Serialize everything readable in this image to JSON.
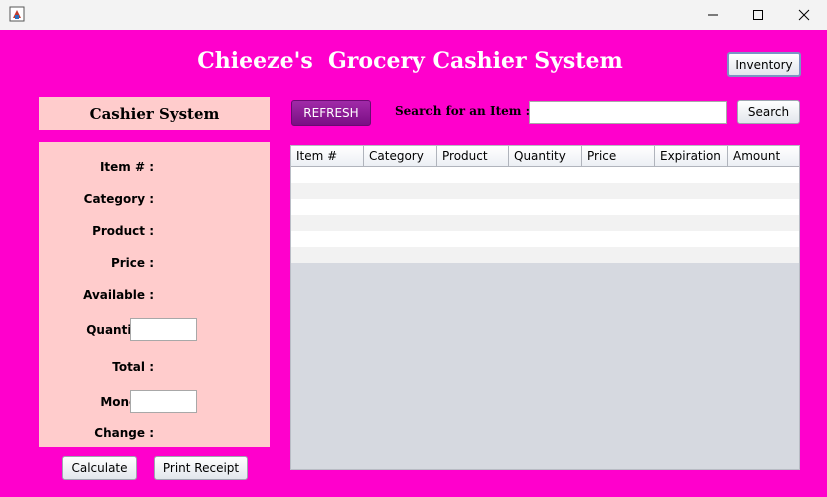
{
  "window": {
    "minimize_glyph": "—",
    "maximize_glyph": "☐",
    "close_glyph": "✕"
  },
  "header": {
    "title": "Chieeze's  Grocery Cashier System",
    "inventory_label": "Inventory"
  },
  "cashier": {
    "heading": "Cashier System",
    "labels": {
      "item": "Item # :",
      "category": "Category :",
      "product": "Product :",
      "price": "Price :",
      "available": "Available :",
      "quantity": "Quantity :",
      "total": "Total :",
      "money": "Money :",
      "change": "Change :"
    },
    "quantity_value": "",
    "money_value": "",
    "calculate_label": "Calculate",
    "print_label": "Print Receipt"
  },
  "toolbar": {
    "refresh_label": "REFRESH",
    "search_label": "Search for an Item :",
    "search_value": "",
    "search_button_label": "Search"
  },
  "table": {
    "columns": [
      "Item #",
      "Category",
      "Product",
      "Quantity",
      "Price",
      "Expiration",
      "Amount"
    ],
    "rows": [
      [],
      [],
      [],
      [],
      [],
      []
    ]
  },
  "colors": {
    "background": "#ff00cc",
    "panel": "#ffcccc",
    "refresh": "#8b1a94"
  }
}
